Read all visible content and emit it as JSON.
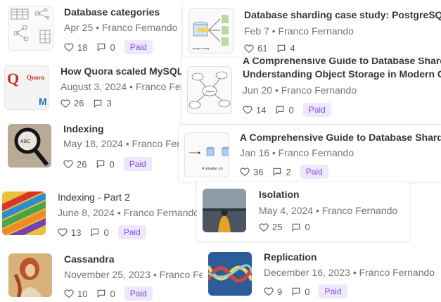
{
  "cards": [
    {
      "id": "db-categories",
      "title": "Database categories",
      "date": "Apr 25",
      "author": "Franco Fernando",
      "likes": "18",
      "comments": "0",
      "badge": "Paid",
      "thumb": "diagram-thumbnail"
    },
    {
      "id": "sharding-case",
      "title": "Database sharding case study: PostgreSQL",
      "date": "Feb 7",
      "author": "Franco Fernando",
      "likes": "61",
      "comments": "4",
      "badge": "",
      "thumb": "diagram-thumbnail"
    },
    {
      "id": "quora",
      "title": "How Quora scaled MySQL",
      "date": "August 3, 2024",
      "author": "Franco Fernando",
      "likes": "26",
      "comments": "3",
      "badge": "",
      "thumb": "quora-logo-thumbnail",
      "logo_text": "Quora"
    },
    {
      "id": "object-storage",
      "title": "Understanding Object Storage in Modern C",
      "title_partial": "A Comprehensive Guide to Database Shardi",
      "date": "Jun 20",
      "author": "Franco Fernando",
      "likes": "14",
      "comments": "0",
      "badge": "Paid",
      "thumb": "mindmap-thumbnail"
    },
    {
      "id": "indexing",
      "title": "Indexing",
      "date": "May 18, 2024",
      "author": "Franco Fer",
      "likes": "26",
      "comments": "0",
      "badge": "Paid",
      "thumb": "magnifier-photo"
    },
    {
      "id": "sharding-guide",
      "title": "A Comprehensive Guide to Database Shardin",
      "date": "Jan 16",
      "author": "Franco Fernando",
      "likes": "36",
      "comments": "2",
      "badge": "Paid",
      "thumb": "sharding-diagram",
      "thumb_caption": "4 smaller sh"
    },
    {
      "id": "indexing-2",
      "title": "Indexing - Part 2",
      "date": "June 8, 2024",
      "author": "Franco Fernando",
      "likes": "13",
      "comments": "0",
      "badge": "Paid",
      "thumb": "index-tabs-photo"
    },
    {
      "id": "isolation",
      "title": "Isolation",
      "date": "May 4, 2024",
      "author": "Franco Fernando",
      "likes": "25",
      "comments": "0",
      "badge": "",
      "thumb": "person-lake-photo"
    },
    {
      "id": "cassandra",
      "title": "Cassandra",
      "date": "November 25, 2023",
      "author": "Franco Fe",
      "likes": "10",
      "comments": "0",
      "badge": "Paid",
      "thumb": "painting-photo"
    },
    {
      "id": "replication",
      "title": "Replication",
      "date": "December 16, 2023",
      "author": "Franco Fernando",
      "likes": "9",
      "comments": "0",
      "badge": "Paid",
      "thumb": "helix-photo"
    }
  ],
  "separator": "•",
  "colors": {
    "title": "#363737",
    "meta": "#757575",
    "badge_bg": "#efe8fd",
    "badge_fg": "#7a4fe0"
  }
}
